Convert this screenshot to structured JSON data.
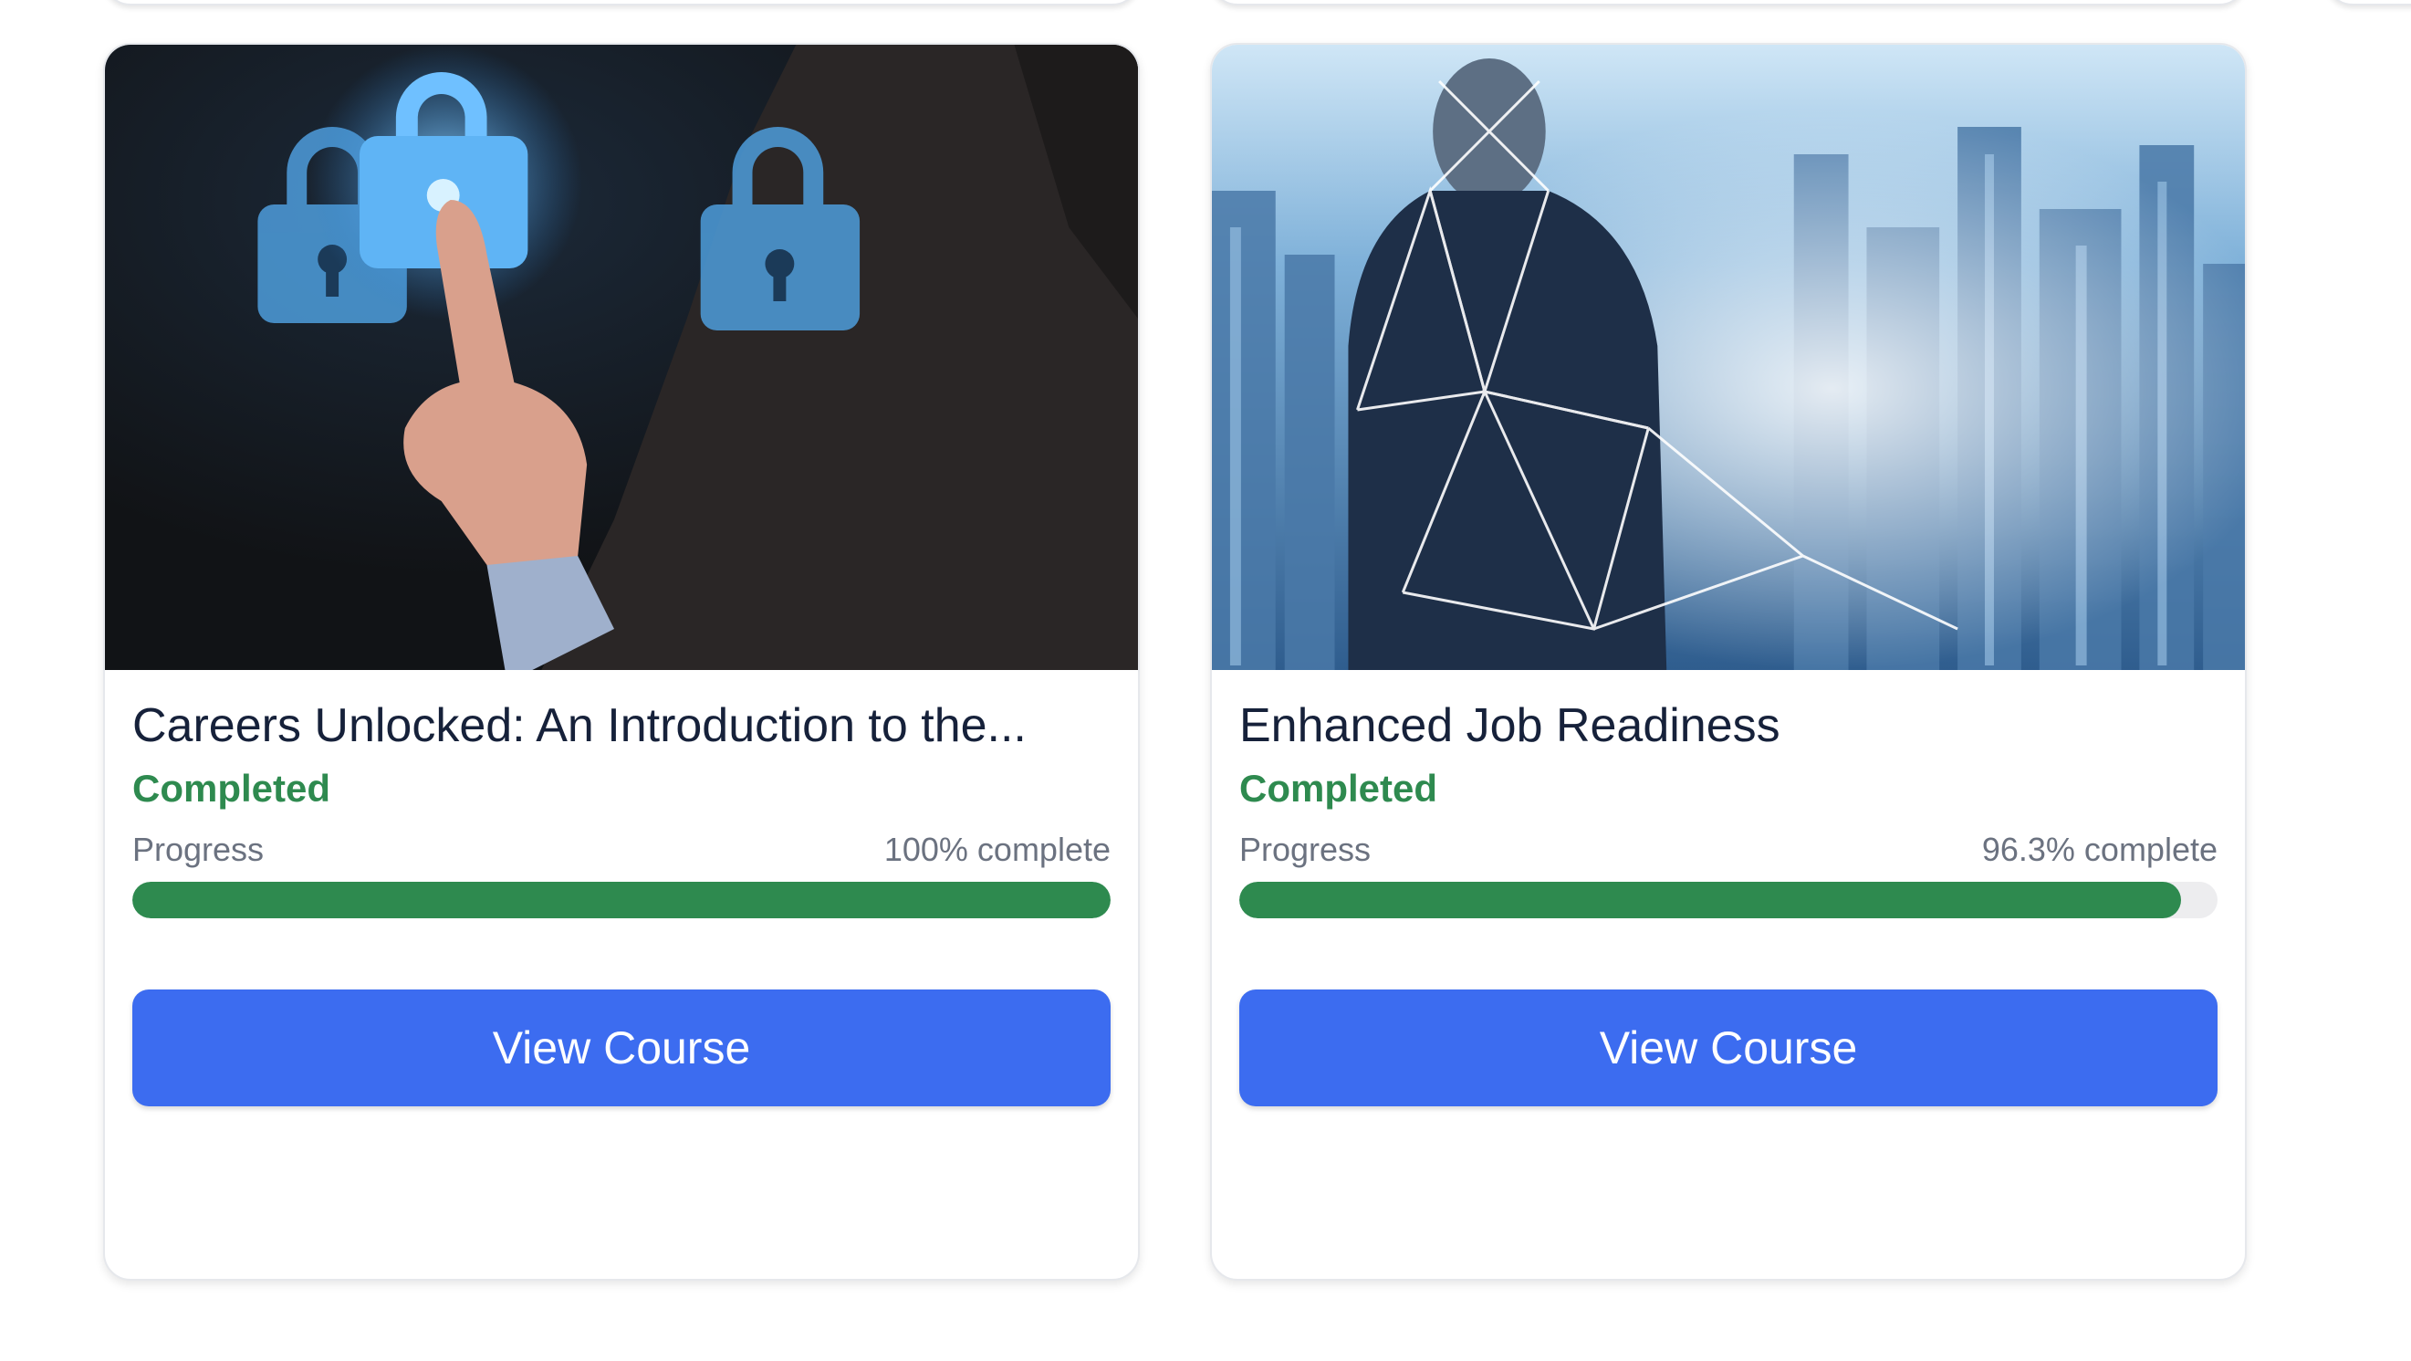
{
  "theme": {
    "accent": "#3c6cf0",
    "completed_color": "#2e8a4f",
    "progress_fill": "#2e8a4f",
    "progress_track": "#ededef"
  },
  "courses": [
    {
      "title": "Careers Unlocked: An Introduction to the...",
      "status": "Completed",
      "progress_label": "Progress",
      "progress_text": "100% complete",
      "progress_value": 100,
      "button_label": "View Course"
    },
    {
      "title": "Enhanced Job Readiness",
      "status": "Completed",
      "progress_label": "Progress",
      "progress_text": "96.3% complete",
      "progress_value": 96.3,
      "button_label": "View Course"
    }
  ]
}
